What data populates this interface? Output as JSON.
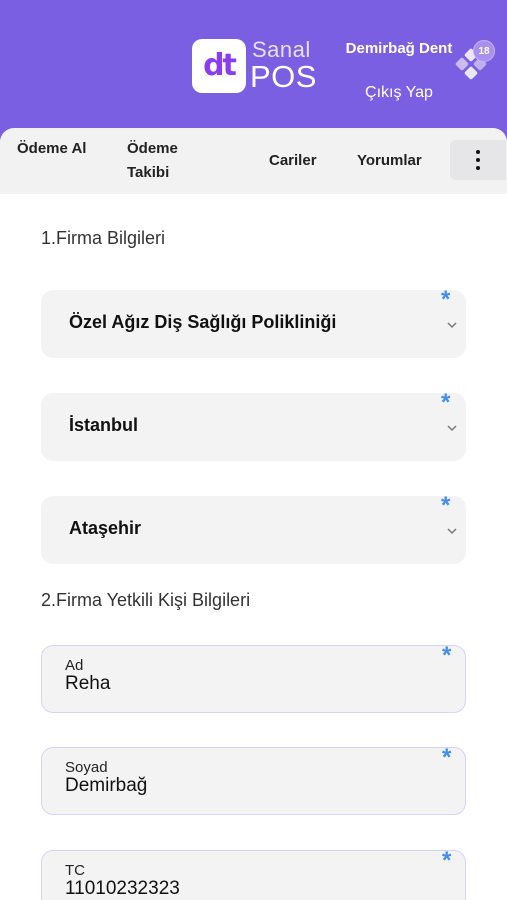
{
  "header": {
    "logo_text": "dt",
    "brand_line1": "Sanal",
    "brand_line2": "POS",
    "user_name": "Demirbağ Dent",
    "logout_label": "Çıkış Yap",
    "notification_count": "18",
    "notification_icon": "puzzle-icon",
    "accent_color": "#7b5fe2"
  },
  "nav": {
    "items": [
      {
        "label": "Ödeme Al"
      },
      {
        "label": "Ödeme Takibi"
      },
      {
        "label": "Cariler"
      },
      {
        "label": "Yorumlar"
      }
    ],
    "menu_icon": "more-vertical-icon"
  },
  "form": {
    "section1_title": "1.Firma Bilgileri",
    "company": {
      "value": "Özel Ağız Diş Sağlığı Polikliniği",
      "required": "*"
    },
    "city": {
      "value": "İstanbul",
      "required": "*"
    },
    "district": {
      "value": "Ataşehir",
      "required": "*"
    },
    "section2_title": "2.Firma Yetkili Kişi Bilgileri",
    "first_name": {
      "label": "Ad",
      "value": "Reha",
      "required": "*"
    },
    "last_name": {
      "label": "Soyad",
      "value": "Demirbağ",
      "required": "*"
    },
    "tc": {
      "label": "TC",
      "value": "11010232323",
      "required": "*"
    }
  }
}
